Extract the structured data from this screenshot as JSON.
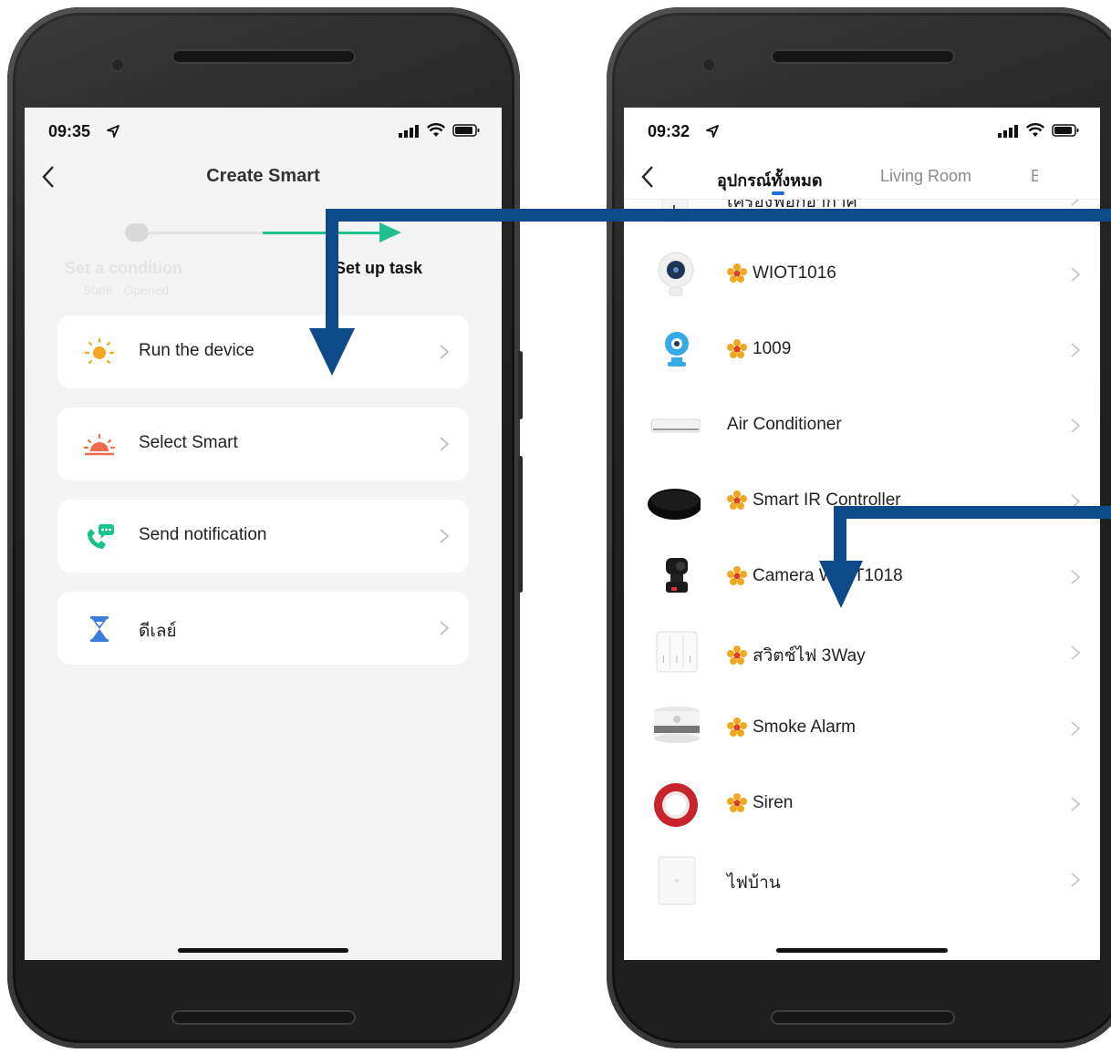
{
  "left_phone": {
    "status_time": "09:35",
    "header": {
      "title": "Create Smart"
    },
    "stepper": {
      "step1_label": "Set a condition",
      "step1_sub": "State : Opened",
      "step2_label": "Set up task"
    },
    "options": [
      {
        "label": "Run the device",
        "icon": "sun-icon"
      },
      {
        "label": "Select Smart",
        "icon": "sunrise-icon"
      },
      {
        "label": "Send notification",
        "icon": "phone-message-icon"
      },
      {
        "label": "ดีเลย์",
        "icon": "hourglass-icon"
      }
    ]
  },
  "right_phone": {
    "status_time": "09:32",
    "tabs": [
      {
        "label": "อุปกรณ์ทั้งหมด",
        "active": true
      },
      {
        "label": "Living Room",
        "active": false
      },
      {
        "label": "E",
        "active": false
      }
    ],
    "devices": [
      {
        "name": "เครื่องฟอกอากาศ",
        "shared": false,
        "icon": "air-purifier-icon"
      },
      {
        "name": "WIOT1016",
        "shared": true,
        "icon": "camera-icon"
      },
      {
        "name": "1009",
        "shared": true,
        "icon": "mini-camera-icon"
      },
      {
        "name": "Air Conditioner",
        "shared": false,
        "icon": "air-conditioner-icon"
      },
      {
        "name": "Smart IR Controller",
        "shared": true,
        "icon": "ir-controller-icon"
      },
      {
        "name": "Camera WIOT1018",
        "shared": true,
        "icon": "ptz-camera-icon"
      },
      {
        "name": "สวิตช์ไฟ 3Way",
        "shared": true,
        "icon": "wall-switch-icon"
      },
      {
        "name": "Smoke Alarm",
        "shared": true,
        "icon": "smoke-alarm-icon"
      },
      {
        "name": "Siren",
        "shared": true,
        "icon": "siren-icon"
      },
      {
        "name": "ไฟบ้าน",
        "shared": false,
        "icon": "light-switch-icon"
      }
    ]
  },
  "colors": {
    "accent_green": "#1fbf8f",
    "tab_indicator": "#1a6dd6",
    "annotation_arrow": "#0d4a8a",
    "icon_orange": "#f5a623",
    "icon_blue": "#3b7ddd"
  }
}
